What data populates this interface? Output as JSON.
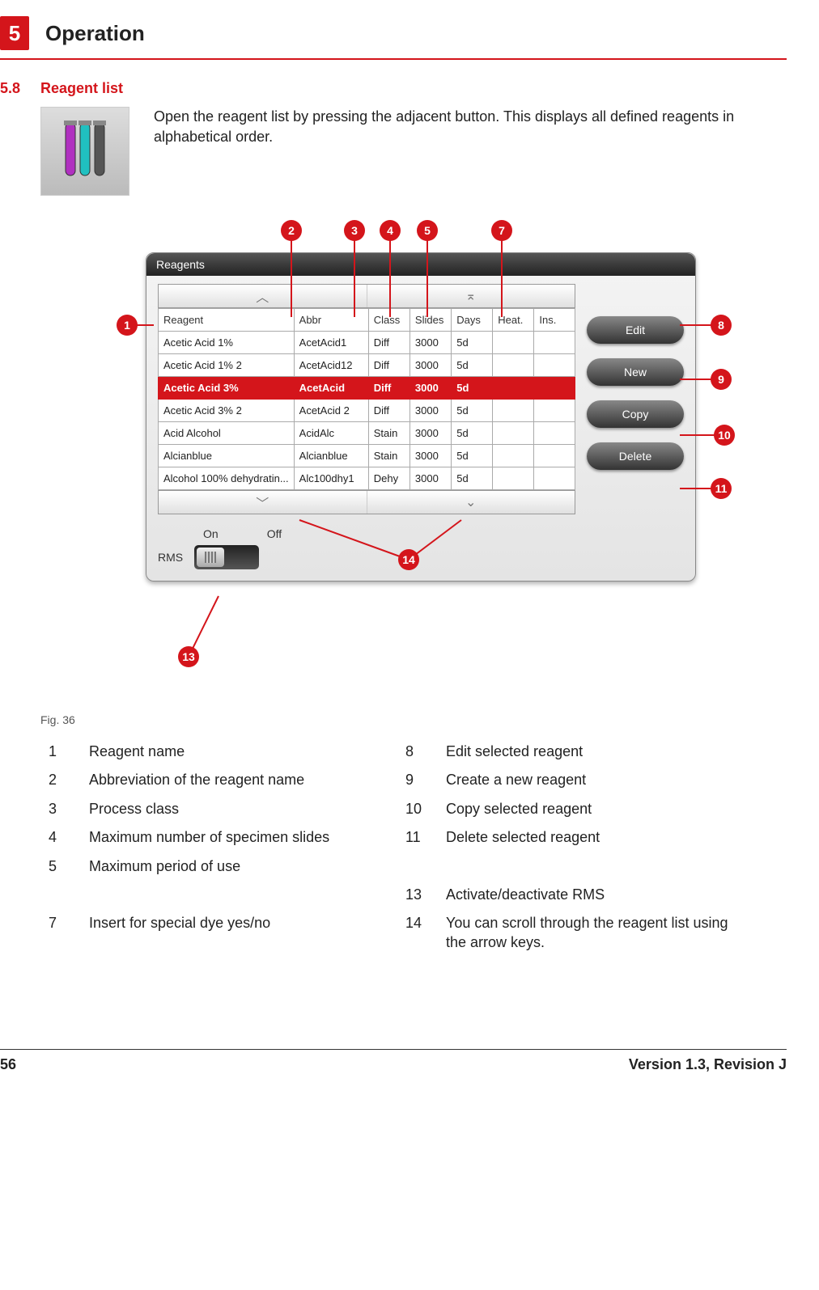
{
  "header": {
    "chapter_number": "5",
    "chapter_title": "Operation"
  },
  "section": {
    "number": "5.8",
    "title": "Reagent list"
  },
  "intro_text": "Open the reagent list by pressing the adjacent button. This displays all defined reagents in alphabetical order.",
  "panel": {
    "title": "Reagents",
    "columns": [
      "Reagent",
      "Abbr",
      "Class",
      "Slides",
      "Days",
      "Heat.",
      "Ins."
    ],
    "rows": [
      {
        "cells": [
          "Acetic Acid 1%",
          "AcetAcid1",
          "Diff",
          "3000",
          "5d",
          "",
          ""
        ],
        "selected": false
      },
      {
        "cells": [
          "Acetic Acid 1% 2",
          "AcetAcid12",
          "Diff",
          "3000",
          "5d",
          "",
          ""
        ],
        "selected": false
      },
      {
        "cells": [
          "Acetic Acid 3%",
          "AcetAcid",
          "Diff",
          "3000",
          "5d",
          "",
          ""
        ],
        "selected": true
      },
      {
        "cells": [
          "Acetic Acid 3% 2",
          "AcetAcid 2",
          "Diff",
          "3000",
          "5d",
          "",
          ""
        ],
        "selected": false
      },
      {
        "cells": [
          "Acid Alcohol",
          "AcidAlc",
          "Stain",
          "3000",
          "5d",
          "",
          ""
        ],
        "selected": false
      },
      {
        "cells": [
          "Alcianblue",
          "Alcianblue",
          "Stain",
          "3000",
          "5d",
          "",
          ""
        ],
        "selected": false
      },
      {
        "cells": [
          "Alcohol 100% dehydratin...",
          "Alc100dhy1",
          "Dehy",
          "3000",
          "5d",
          "",
          ""
        ],
        "selected": false
      }
    ],
    "buttons": {
      "edit": "Edit",
      "new": "New",
      "copy": "Copy",
      "delete": "Delete"
    },
    "onoff": {
      "on": "On",
      "off": "Off"
    },
    "rms": "RMS"
  },
  "figure_caption": "Fig. 36",
  "legend": {
    "1": "Reagent name",
    "2": "Abbreviation of the reagent name",
    "3": "Process class",
    "4": "Maximum number of specimen slides",
    "5": "Maximum period of use",
    "7": "Insert for special dye yes/no",
    "8": "Edit selected reagent",
    "9": "Create a new reagent",
    "10": "Copy selected reagent",
    "11": "Delete selected reagent",
    "13": "Activate/deactivate RMS",
    "14": "You can scroll through the reagent list using the arrow keys."
  },
  "footer": {
    "page": "56",
    "version": "Version 1.3, Revision J"
  }
}
